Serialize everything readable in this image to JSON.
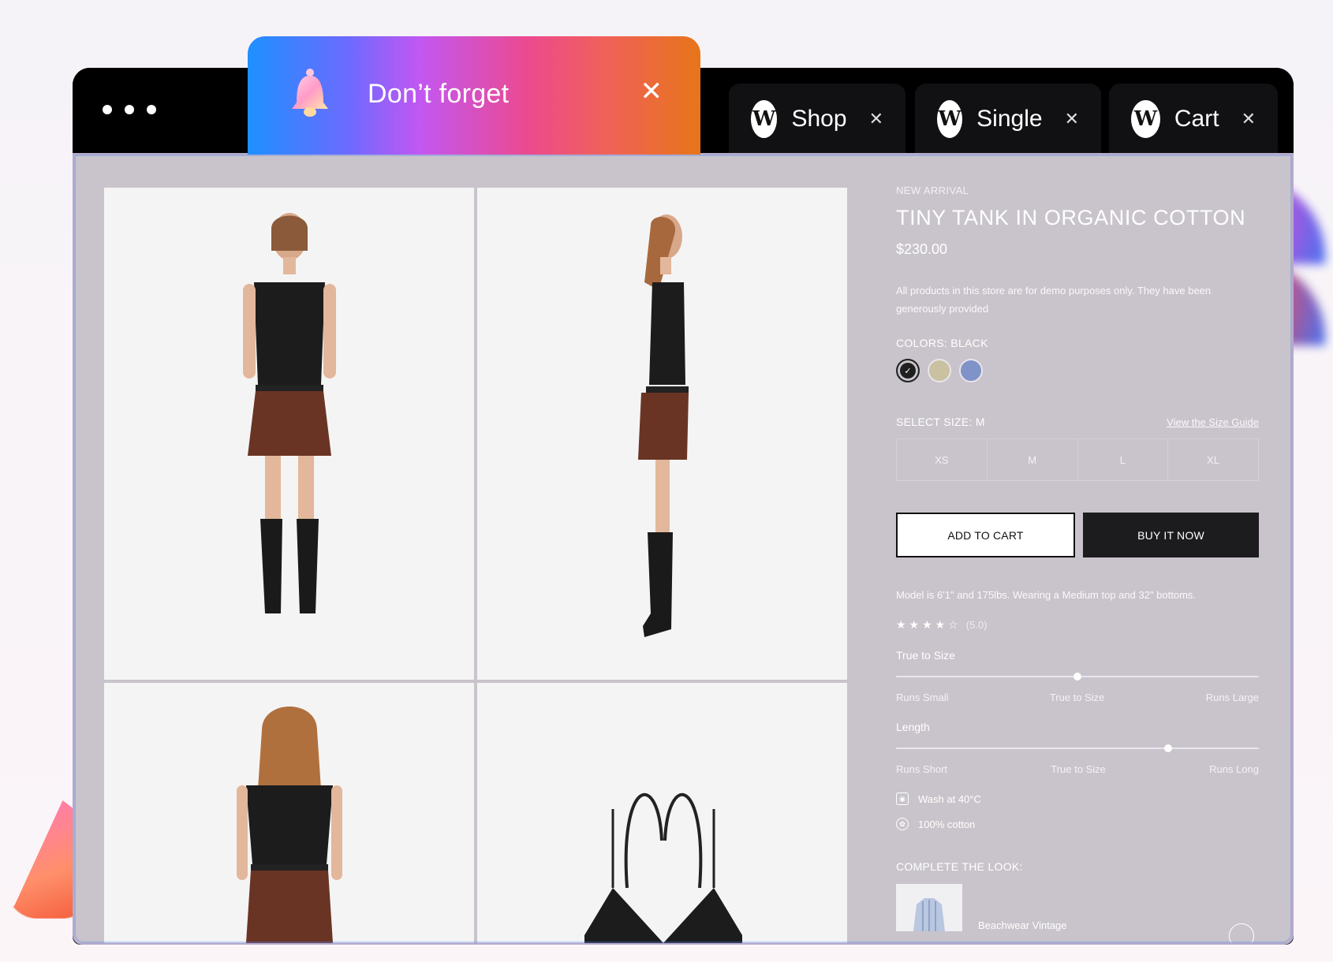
{
  "window": {
    "tabs": [
      {
        "logo": "W",
        "label": "Shop"
      },
      {
        "logo": "W",
        "label": "Single"
      },
      {
        "logo": "W",
        "label": "Cart"
      }
    ]
  },
  "notification": {
    "text": "Don’t forget",
    "icon": "bell-icon",
    "close_icon": "close-icon"
  },
  "product": {
    "eyebrow": "NEW ARRIVAL",
    "title": "TINY TANK IN ORGANIC COTTON",
    "price": "$230.00",
    "description": "All products in this store are for demo purposes only. They have been generously provided",
    "colors_label": "COLORS: BLACK",
    "colors": [
      "#1f1f1f",
      "#c9c1a0",
      "#7f93c8"
    ],
    "selected_color_index": 0,
    "size_label": "SELECT SIZE: M",
    "size_guide": "View the Size Guide",
    "sizes": [
      "XS",
      "M",
      "L",
      "XL"
    ],
    "add_to_cart": "ADD TO CART",
    "buy_now": "BUY IT NOW",
    "model_info": "Model is 6'1\" and 175lbs. Wearing a Medium top and 32\" bottoms.",
    "stars": "★★★★☆",
    "rating": "(5.0)",
    "fit": [
      {
        "title": "True to Size",
        "low": "Runs Small",
        "mid": "True to Size",
        "high": "Runs Large",
        "value": 0.5
      },
      {
        "title": "Length",
        "low": "Runs Short",
        "mid": "True to Size",
        "high": "Runs Long",
        "value": 0.75
      }
    ],
    "care": [
      {
        "icon": "washing-icon",
        "text": "Wash at 40°C"
      },
      {
        "icon": "cotton-icon",
        "text": "100% cotton"
      }
    ],
    "complete_look_label": "COMPLETE THE LOOK:",
    "look_item": "Beachwear Vintage"
  }
}
